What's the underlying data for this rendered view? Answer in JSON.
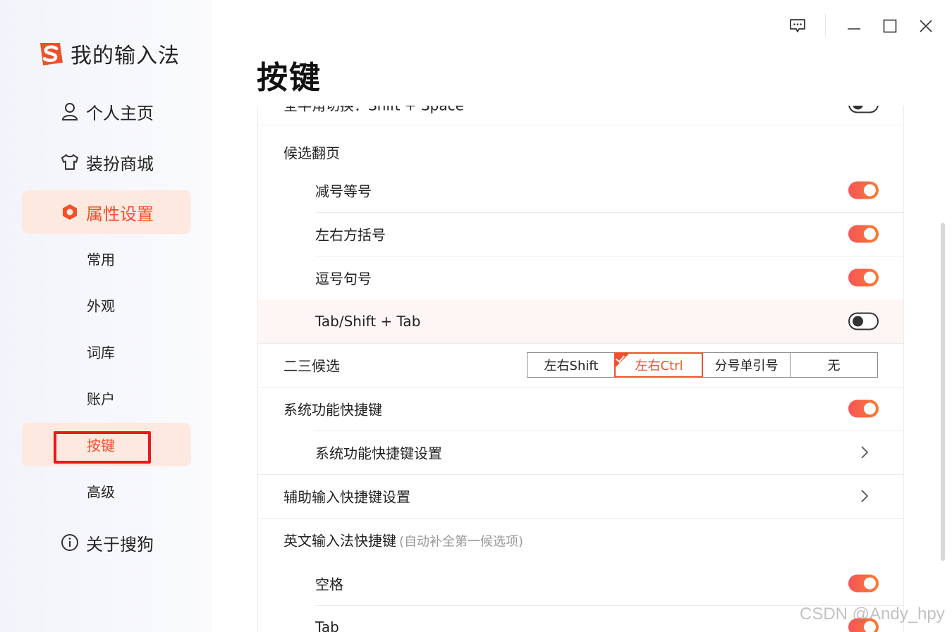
{
  "app": {
    "name": "我的输入法"
  },
  "colors": {
    "accent": "#f0502a",
    "active_bg": "#fde9e0",
    "toggle_on_start": "#f6555a",
    "toggle_on_end": "#fb7b2f",
    "annotation_box": "#e8191a"
  },
  "sidebar": {
    "main_items": [
      {
        "label": "个人主页",
        "icon": "user-icon"
      },
      {
        "label": "装扮商城",
        "icon": "shirt-icon"
      },
      {
        "label": "属性设置",
        "icon": "settings-hex-icon",
        "active": true
      }
    ],
    "sub_items": [
      {
        "label": "常用"
      },
      {
        "label": "外观"
      },
      {
        "label": "词库"
      },
      {
        "label": "账户"
      },
      {
        "label": "按键",
        "active": true,
        "annotated": true
      },
      {
        "label": "高级"
      }
    ],
    "about": {
      "label": "关于搜狗",
      "icon": "info-icon"
    }
  },
  "window_controls": [
    "feedback-icon",
    "minimize-icon",
    "maximize-icon",
    "close-icon"
  ],
  "page": {
    "title": "按键"
  },
  "settings": {
    "partial_top_row": {
      "label": "全半角切换：Shift + Space",
      "toggle": false
    },
    "page_turn": {
      "label": "候选翻页",
      "items": [
        {
          "label": "减号等号",
          "toggle": true
        },
        {
          "label": "左右方括号",
          "toggle": true
        },
        {
          "label": "逗号句号",
          "toggle": true
        },
        {
          "label": "Tab/Shift + Tab",
          "toggle": false
        }
      ]
    },
    "second_third": {
      "label": "二三候选",
      "options": [
        "左右Shift",
        "左右Ctrl",
        "分号单引号",
        "无"
      ],
      "selected": "左右Ctrl"
    },
    "system_hotkeys": {
      "label": "系统功能快捷键",
      "toggle": true,
      "sub_label": "系统功能快捷键设置"
    },
    "aux_input": {
      "label": "辅助输入快捷键设置"
    },
    "english": {
      "label": "英文输入法快捷键",
      "hint": "(自动补全第一候选项)",
      "items": [
        {
          "label": "空格",
          "toggle": true
        },
        {
          "label": "Tab",
          "toggle": true
        }
      ]
    }
  },
  "watermark": "CSDN @Andy_hpy"
}
